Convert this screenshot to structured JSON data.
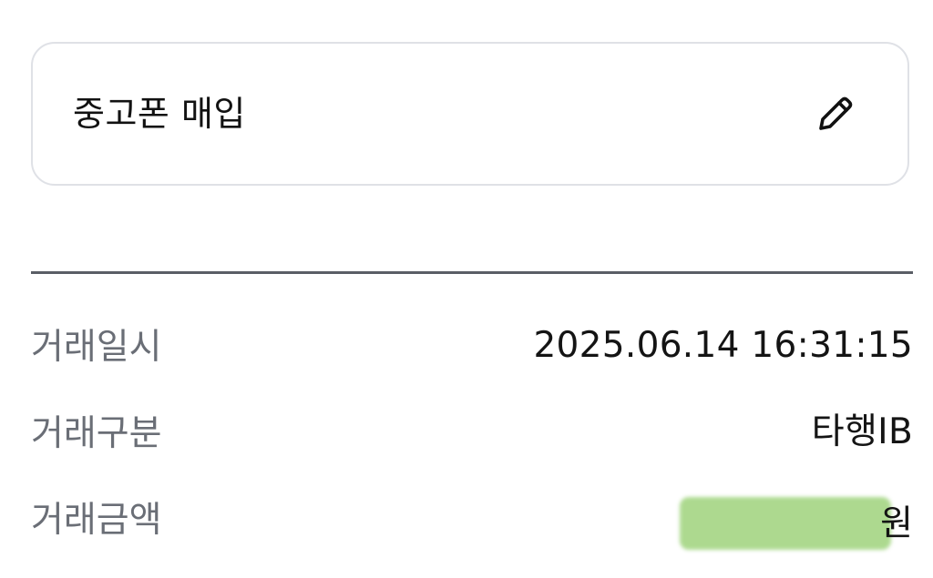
{
  "memo": {
    "text": "중고폰 매입",
    "edit_icon": "pencil-icon"
  },
  "details": {
    "datetime": {
      "label": "거래일시",
      "value": "2025.06.14 16:31:15"
    },
    "type": {
      "label": "거래구분",
      "value": "타행IB"
    },
    "amount": {
      "label": "거래금액",
      "unit": "원"
    }
  },
  "colors": {
    "card_border": "#dfe1e6",
    "divider": "#5a5e66",
    "label_text": "#6a6e76",
    "value_text": "#141414",
    "redaction": "#a9d88a"
  }
}
